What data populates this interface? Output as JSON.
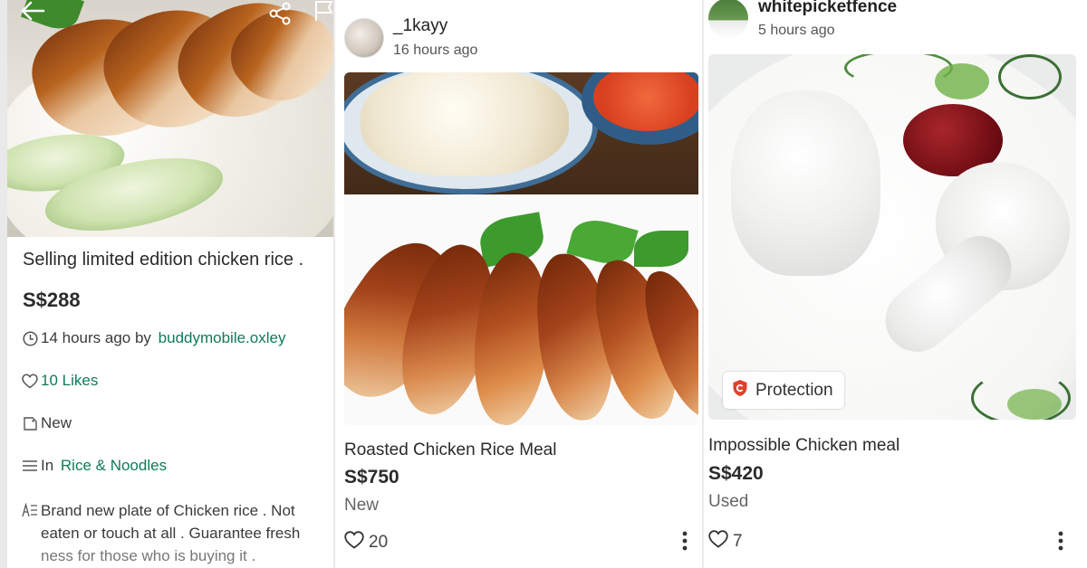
{
  "left_listing": {
    "title": "Selling limited edition chicken rice .",
    "price": "S$288",
    "time_prefix": "14 hours ago by ",
    "seller": "buddymobile.oxley",
    "likes": "10 Likes",
    "condition": "New",
    "category_prefix": "In ",
    "category": "Rice & Noodles",
    "description_lines": [
      "Brand new plate of Chicken rice . Not",
      "eaten or touch at all . Guarantee fresh",
      "ness for those who is buying it ."
    ]
  },
  "listings": [
    {
      "seller": "_1kayy",
      "posted": "16 hours ago",
      "title": "Roasted Chicken Rice Meal",
      "price": "S$750",
      "condition": "New",
      "likes": "20"
    },
    {
      "seller": "whitepicketfence",
      "posted": "5 hours ago",
      "title": "Impossible Chicken meal",
      "price": "S$420",
      "condition": "Used",
      "likes": "7",
      "badge": "Protection"
    }
  ],
  "colors": {
    "link": "#0f7a5a",
    "protection_shield": "#e0402f"
  },
  "icons": [
    "back-arrow-icon",
    "share-icon",
    "flag-icon",
    "clock-icon",
    "heart-icon",
    "tag-icon",
    "list-icon",
    "description-icon",
    "more-vertical-icon",
    "shield-icon"
  ]
}
